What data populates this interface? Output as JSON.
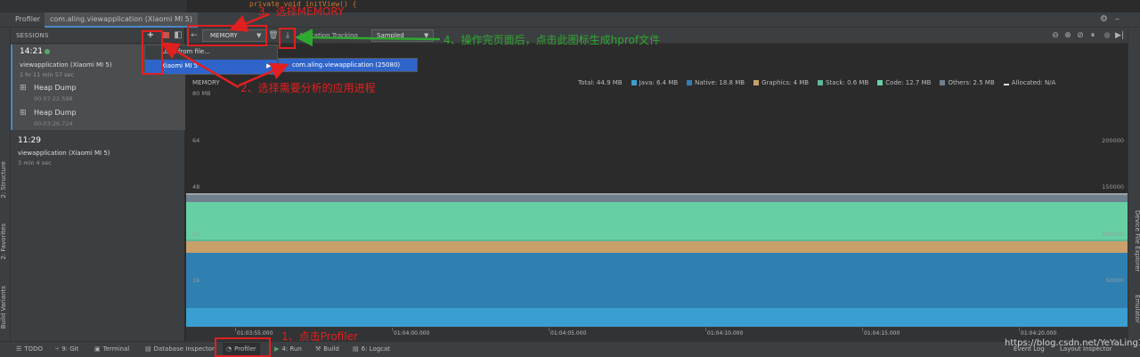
{
  "title_bar": {
    "tool_label": "Profiler",
    "process_tab": "com.aling.viewapplication (Xiaomi MI 5)"
  },
  "sessions": {
    "header": "SESSIONS",
    "add_label": "+",
    "items": [
      {
        "time": "14:21",
        "name": "viewapplication (Xiaomi MI 5)",
        "duration": "1 hr 11 min 57 sec",
        "dumps": [
          {
            "label": "Heap Dump",
            "time": "00:07:22.598"
          },
          {
            "label": "Heap Dump",
            "time": "00:03:26.724"
          }
        ]
      },
      {
        "time": "11:29",
        "name": "viewapplication (Xiaomi MI 5)",
        "duration": "3 min 4 sec"
      }
    ]
  },
  "dropdown": {
    "load_from_file": "Load from file...",
    "device": "Xiaomi MI 5",
    "process": "com.aling.viewapplication (25080)"
  },
  "toolbar": {
    "profiler_select": "MEMORY",
    "allocation_tracking_label": "Allocation Tracking",
    "allocation_tracking_value": "Sampled"
  },
  "chart_data": {
    "type": "area",
    "title": "MEMORY",
    "legend": [
      {
        "name": "Total: 44.9 MB",
        "color": ""
      },
      {
        "name": "Java: 6.4 MB",
        "color": "#3a9fd0"
      },
      {
        "name": "Native: 18.8 MB",
        "color": "#2f7fb0"
      },
      {
        "name": "Graphics: 4 MB",
        "color": "#c9a06a"
      },
      {
        "name": "Stack: 0.6 MB",
        "color": "#5fb89a"
      },
      {
        "name": "Code: 12.7 MB",
        "color": "#66d0a4"
      },
      {
        "name": "Others: 2.5 MB",
        "color": "#6e7f8e"
      },
      {
        "name": "Allocated: N/A",
        "color": ""
      }
    ],
    "y_left_ticks": [
      "80 MB",
      "64",
      "48",
      "32",
      "16"
    ],
    "y_right_ticks": [
      "200000",
      "150000",
      "100000",
      "50000"
    ],
    "x_ticks": [
      "01:03:55.000",
      "01:04:00.000",
      "01:04:05.000",
      "01:04:10.000",
      "01:04:15.000",
      "01:04:20.000"
    ],
    "ylim": [
      0,
      80
    ],
    "stack": [
      {
        "name": "Java",
        "value": 6.4,
        "color": "#3a9fd0"
      },
      {
        "name": "Native",
        "value": 18.8,
        "color": "#2f7fb0"
      },
      {
        "name": "Graphics",
        "value": 4,
        "color": "#c9a06a"
      },
      {
        "name": "Stack",
        "value": 0.6,
        "color": "#5fb89a"
      },
      {
        "name": "Code",
        "value": 12.7,
        "color": "#66d0a4"
      },
      {
        "name": "Others",
        "value": 2.5,
        "color": "#6e7f8e"
      }
    ]
  },
  "status_bar": {
    "items": [
      "TODO",
      "9: Git",
      "Terminal",
      "Database Inspector",
      "Profiler",
      "4: Run",
      "Build",
      "6: Logcat"
    ],
    "right_items": [
      "Event Log",
      "Layout Inspector"
    ]
  },
  "left_strip": [
    "2: Structure",
    "2: Favorites",
    "Build Variants"
  ],
  "right_strip": [
    "Device File Explorer",
    "Emulator"
  ],
  "annotations": {
    "step1": "1、点击Profiler",
    "step2": "2、选择需要分析的应用进程",
    "step3": "3、选择MEMORY",
    "step4": "4、操作完页面后，点击此图标生成hprof文件"
  },
  "watermark": "https://blog.csdn.net/YeYaLing123",
  "code_strip": {
    "line": "private void initView() {"
  }
}
